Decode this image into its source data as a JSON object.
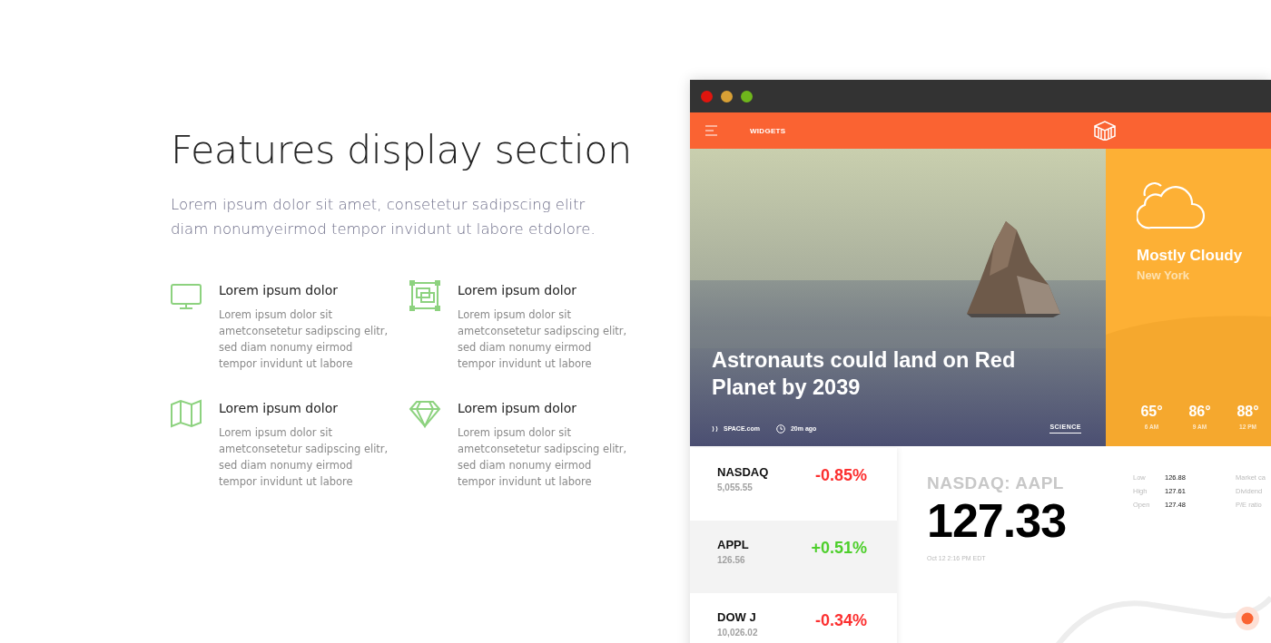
{
  "section": {
    "title": "Features display section",
    "intro": "Lorem ipsum dolor sit amet, consetetur sadipscing elitr diam nonumyeirmod tempor invidunt ut labore etdolore."
  },
  "features": [
    {
      "kind": "monitor",
      "title": "Lorem ipsum dolor",
      "text": "Lorem ipsum dolor sit ametconsetetur sadipscing elitr, sed diam nonumy eirmod tempor invidunt ut labore"
    },
    {
      "kind": "layers",
      "title": "Lorem ipsum dolor",
      "text": "Lorem ipsum dolor sit ametconsetetur sadipscing elitr, sed diam nonumy eirmod tempor invidunt ut labore"
    },
    {
      "kind": "map",
      "title": "Lorem ipsum dolor",
      "text": "Lorem ipsum dolor sit ametconsetetur sadipscing elitr, sed diam nonumy eirmod tempor invidunt ut labore"
    },
    {
      "kind": "diamond",
      "title": "Lorem ipsum dolor",
      "text": "Lorem ipsum dolor sit ametconsetetur sadipscing elitr, sed diam nonumy eirmod tempor invidunt ut labore"
    }
  ],
  "app": {
    "nav": {
      "label": "WIDGETS"
    },
    "news": {
      "kind": "picture",
      "headline": "Astronauts could land on Red Planet by 2039",
      "source": "SPACE.com",
      "time": "20m ago",
      "category": "SCIENCE"
    },
    "weather": {
      "condition": "Mostly Cloudy",
      "city": "New York",
      "forecast": [
        {
          "temp": "65°",
          "time": "6 AM"
        },
        {
          "temp": "86°",
          "time": "9 AM"
        },
        {
          "temp": "88°",
          "time": "12 PM"
        }
      ]
    },
    "stocks": [
      {
        "name": "NASDAQ",
        "value": "5,055.55",
        "change": "-0.85%",
        "kind": "down",
        "selected": false
      },
      {
        "name": "APPL",
        "value": "126.56",
        "change": "+0.51%",
        "kind": "up",
        "selected": true
      },
      {
        "name": "DOW J",
        "value": "10,026.02",
        "change": "-0.34%",
        "kind": "down",
        "selected": false
      }
    ],
    "detail": {
      "ticker": "NASDAQ: AAPL",
      "price": "127.33",
      "timestamp": "Oct 12 2:16 PM EDT",
      "stats": [
        {
          "label": "Low",
          "value": "126.88"
        },
        {
          "label": "High",
          "value": "127.61"
        },
        {
          "label": "Open",
          "value": "127.48"
        }
      ],
      "more_stats": [
        "Market ca",
        "Dividend",
        "P/E ratio"
      ]
    }
  }
}
